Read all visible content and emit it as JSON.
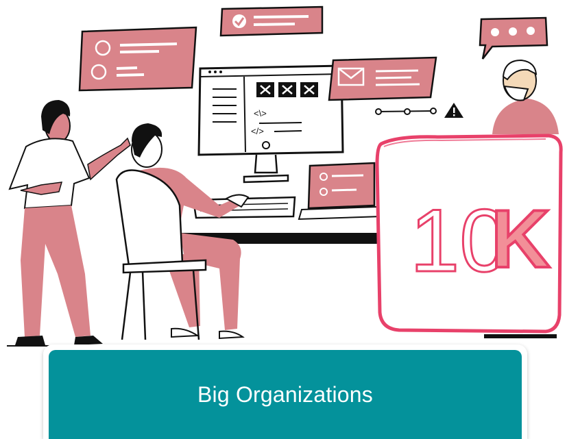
{
  "badge": {
    "number": "10",
    "suffix": "K"
  },
  "monitor": {
    "code_tag": "<\\>",
    "closing_tag": "</>"
  },
  "caption": {
    "label": "Big Organizations"
  },
  "colors": {
    "accent_pink": "#d9848a",
    "badge_border": "#e8416a",
    "caption_bg": "#04929b",
    "ink": "#111111"
  },
  "icons": [
    "check-icon",
    "envelope-icon",
    "chat-dots-icon",
    "warning-icon",
    "x-icon"
  ]
}
